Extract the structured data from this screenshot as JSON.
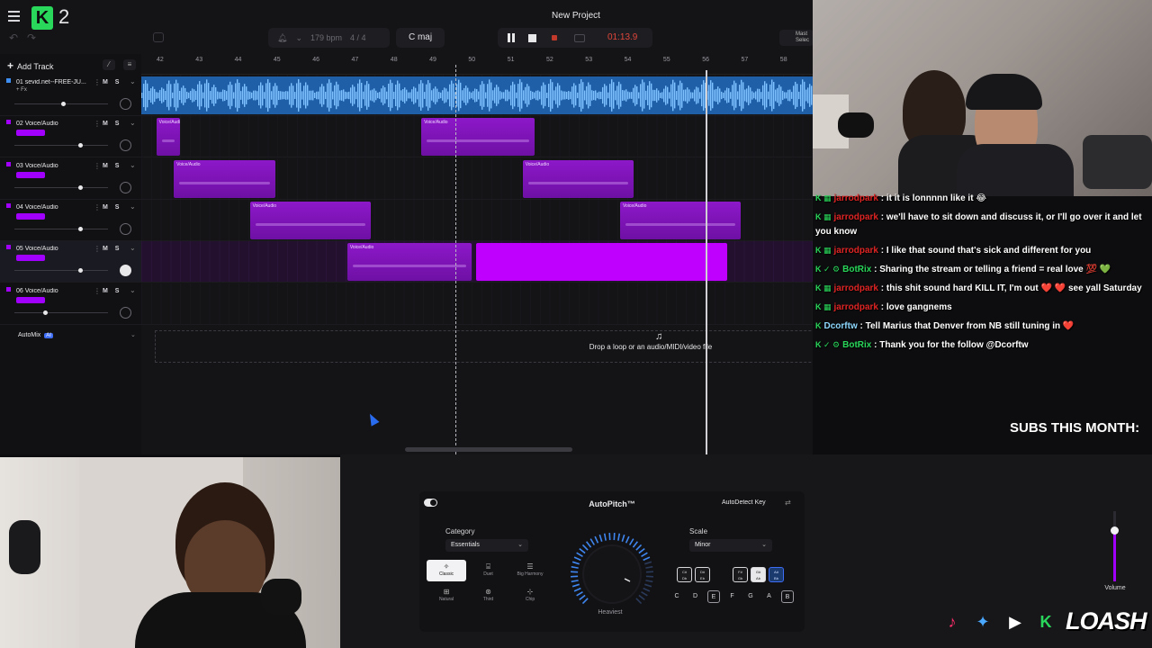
{
  "app": {
    "project_title": "New Project",
    "logo_suffix": "2"
  },
  "toolbar": {
    "bpm": "179 bpm",
    "time_signature": "4 / 4",
    "key": "C maj",
    "timecode": "01:13.9",
    "master_label": "Mast",
    "master_sub": "Selec"
  },
  "sidebar": {
    "add_track": "Add Track",
    "automix": "AutoMix",
    "automix_badge": "AI"
  },
  "ruler": {
    "bars": [
      "42",
      "43",
      "44",
      "45",
      "46",
      "47",
      "48",
      "49",
      "50",
      "51",
      "52",
      "53",
      "54",
      "55",
      "56",
      "57",
      "58"
    ]
  },
  "tracks": [
    {
      "name": "01 sevid.net--FREE-JU...",
      "fx": "+ Fx",
      "ms": "M S",
      "volume": 0.52,
      "color": "#3d8ef0"
    },
    {
      "name": "02 Voice/Audio",
      "ms": "M S",
      "volume": 0.7,
      "color": "#a100ff"
    },
    {
      "name": "03 Voice/Audio",
      "ms": "M S",
      "volume": 0.7,
      "color": "#a100ff"
    },
    {
      "name": "04 Voice/Audio",
      "ms": "M S",
      "volume": 0.7,
      "color": "#a100ff"
    },
    {
      "name": "05 Voice/Audio",
      "ms": "M S",
      "volume": 0.7,
      "color": "#a100ff"
    },
    {
      "name": "06 Voice/Audio",
      "ms": "M S",
      "volume": 0.33,
      "color": "#a100ff"
    }
  ],
  "clips": {
    "label": "Voice/Audio"
  },
  "dropzone": {
    "text": "Drop a loop or an audio/MIDI/video file"
  },
  "chat": [
    {
      "user": "jarrodpark",
      "user_color": "red",
      "message": "it it is lonnnnn like it 😂",
      "badges": "K ▦"
    },
    {
      "user": "jarrodpark",
      "user_color": "red",
      "message": "we'll have to sit down and discuss it, or I'll go over it and let you know",
      "badges": "K ▦"
    },
    {
      "user": "jarrodpark",
      "user_color": "red",
      "message": "I like that sound that's sick and different for you",
      "badges": "K ▦"
    },
    {
      "user": "BotRix",
      "user_color": "green",
      "message": "Sharing the stream or telling a friend = real love 💯 💚",
      "badges": "K ✓ ⚙"
    },
    {
      "user": "jarrodpark",
      "user_color": "red",
      "message": "this shit sound hard KILL IT, I'm out ❤️ ❤️ see yall Saturday",
      "badges": "K ▦"
    },
    {
      "user": "jarrodpark",
      "user_color": "red",
      "message": "love gangnems",
      "badges": "K ▦"
    },
    {
      "user": "Dcorftw",
      "user_color": "blue",
      "message": "Tell Marius that Denver from NB still tuning in ❤️",
      "badges": "K"
    },
    {
      "user": "BotRix",
      "user_color": "green",
      "message": "Thank you for the follow @Dcorftw",
      "badges": "K ✓ ⚙"
    }
  ],
  "overlay": {
    "subs": "SUBS THIS MONTH:",
    "brand": "LOASH"
  },
  "autopitch": {
    "title": "AutoPitch™",
    "autodetect": "AutoDetect Key",
    "category_label": "Category",
    "category_value": "Essentials",
    "scale_label": "Scale",
    "scale_value": "Minor",
    "knob_label": "Heaviest",
    "presets": [
      {
        "label": "Classic",
        "selected": true
      },
      {
        "label": "Duet",
        "selected": false
      },
      {
        "label": "Big Harmony",
        "selected": false
      },
      {
        "label": "Natural",
        "selected": false
      },
      {
        "label": "Third",
        "selected": false
      },
      {
        "label": "Chip",
        "selected": false
      }
    ],
    "sharp_keys": [
      {
        "label": "C#\nDb",
        "state": "on"
      },
      {
        "label": "D#\nEb",
        "state": "on"
      },
      {
        "label": "F#\nGb",
        "state": "on"
      },
      {
        "label": "G#\nAb",
        "state": "active"
      },
      {
        "label": "A#\nBb",
        "state": "blue"
      }
    ],
    "natural_keys": [
      {
        "label": "C",
        "boxed": false
      },
      {
        "label": "D",
        "boxed": false
      },
      {
        "label": "E",
        "boxed": true
      },
      {
        "label": "F",
        "boxed": false
      },
      {
        "label": "G",
        "boxed": false
      },
      {
        "label": "A",
        "boxed": false
      },
      {
        "label": "B",
        "boxed": true
      }
    ]
  },
  "volume": {
    "label": "Volume",
    "level": 0.72
  },
  "colors": {
    "accent_purple": "#a100ff",
    "audio_blue": "#3d8ef0",
    "brand_green": "#29d85a",
    "record_red": "#e0453a"
  }
}
